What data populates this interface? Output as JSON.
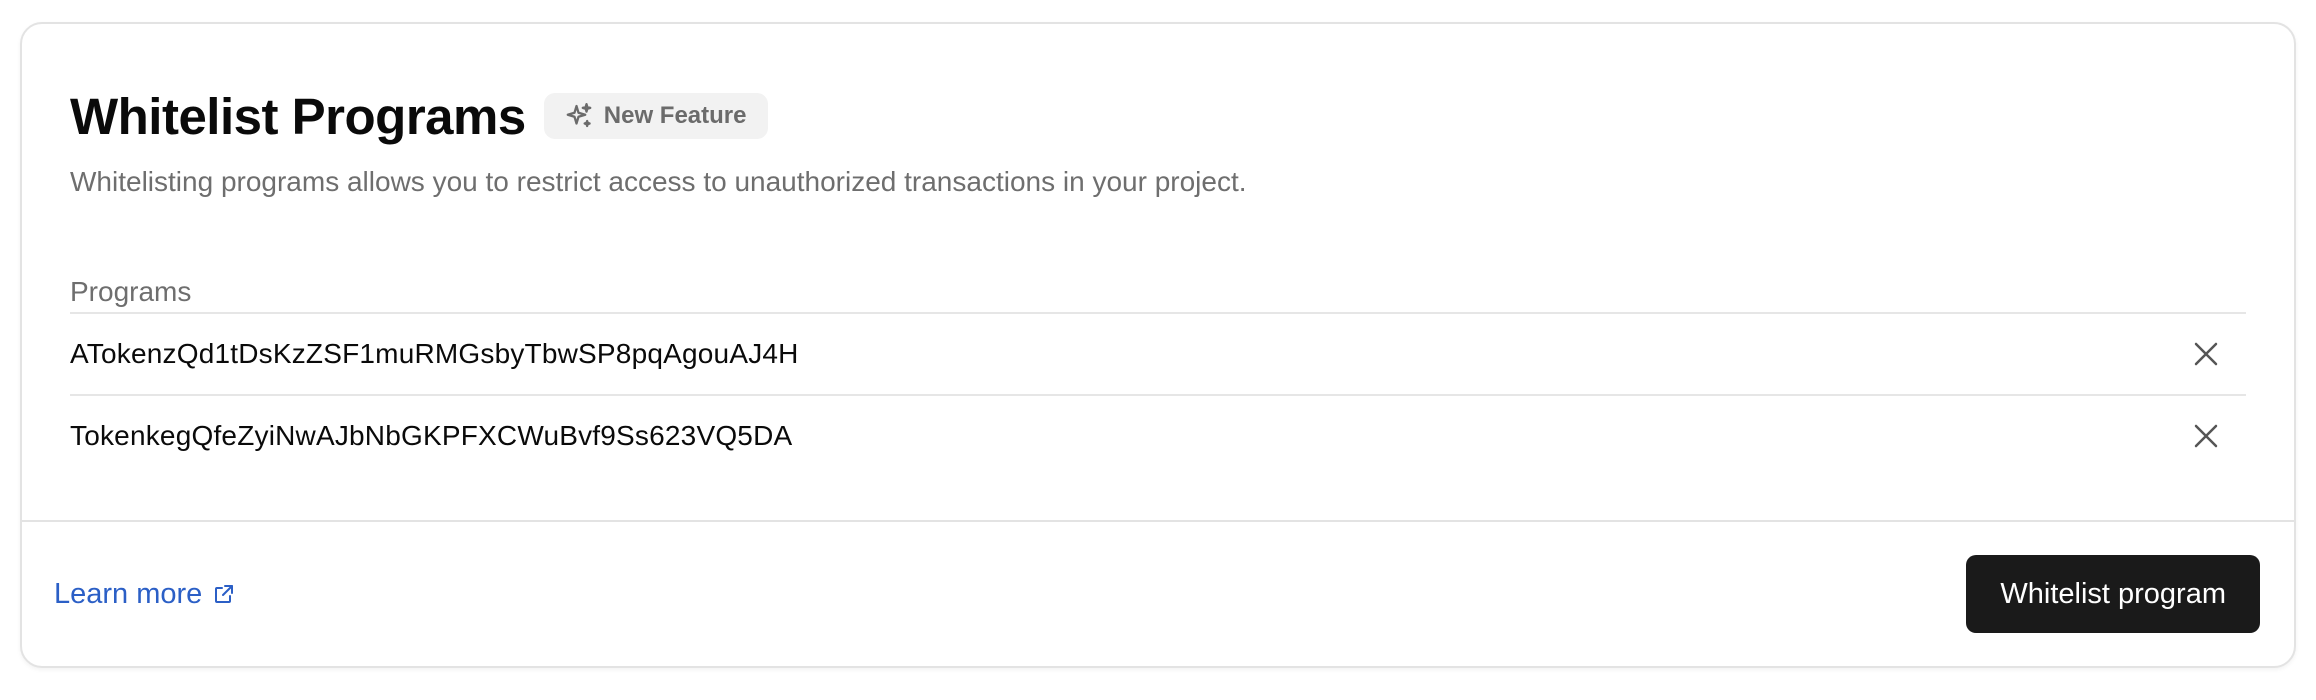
{
  "section": {
    "title": "Whitelist Programs",
    "badge": {
      "icon": "sparkles-icon",
      "label": "New Feature"
    },
    "description": "Whitelisting programs allows you to restrict access to unauthorized transactions in your project."
  },
  "programs": {
    "header": "Programs",
    "items": [
      {
        "address": "ATokenzQd1tDsKzZSF1muRMGsbyTbwSP8pqAgouAJ4H",
        "remove_icon": "close-icon"
      },
      {
        "address": "TokenkegQfeZyiNwAJbNbGKPFXCWuBvf9Ss623VQ5DA",
        "remove_icon": "close-icon"
      }
    ]
  },
  "footer": {
    "learn_more_label": "Learn more",
    "learn_more_icon": "external-link-icon",
    "primary_button_label": "Whitelist program"
  },
  "colors": {
    "link": "#2b5fc6",
    "primary_button_bg": "#1a1a1a",
    "badge_bg": "#f2f2f2",
    "muted_text": "#6e6e6e"
  }
}
